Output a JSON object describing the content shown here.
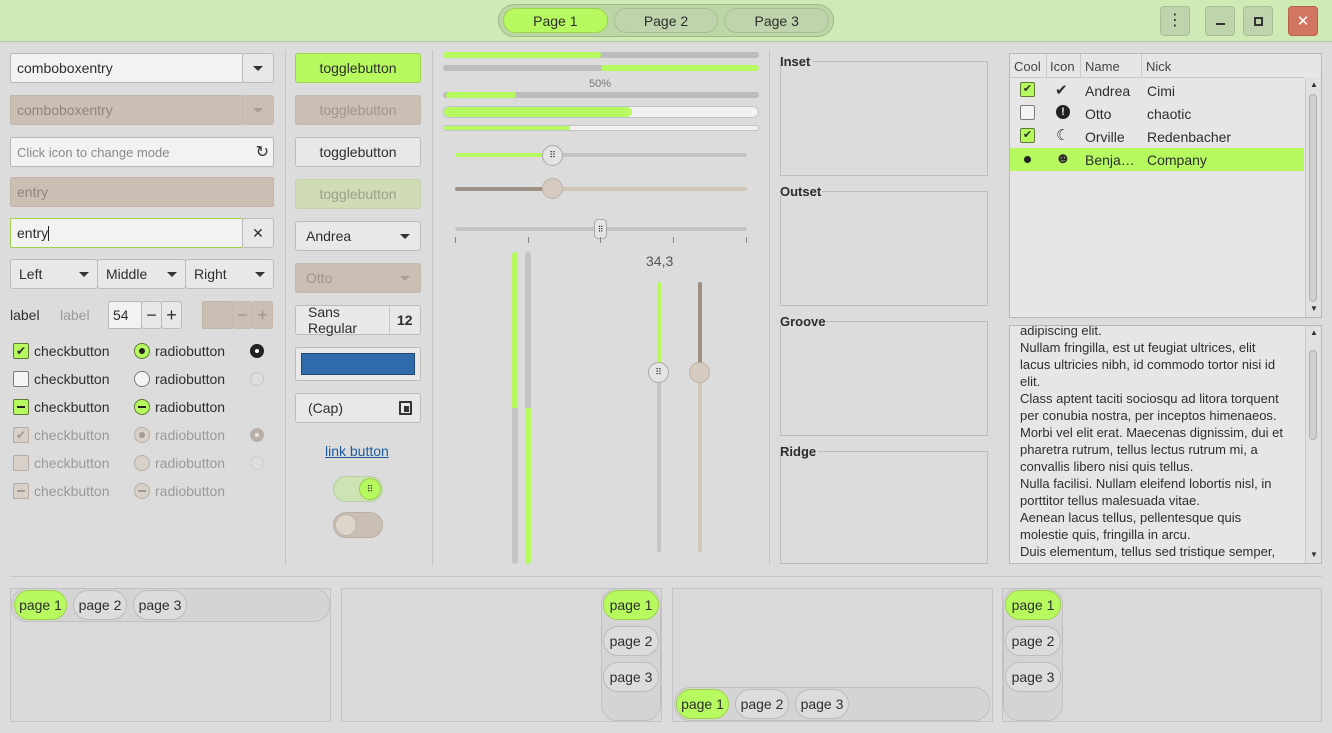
{
  "header": {
    "pages": [
      "Page 1",
      "Page 2",
      "Page 3"
    ],
    "active_page": 0
  },
  "col1": {
    "combo1": "comboboxentry",
    "combo2": "comboboxentry",
    "icon_entry_placeholder": "Click icon to change mode",
    "entry_disabled": "entry",
    "entry_focus": "entry",
    "seg": [
      "Left",
      "Middle",
      "Right"
    ],
    "label1": "label",
    "label2": "label",
    "spin_value": "54",
    "checks": [
      "checkbutton",
      "checkbutton",
      "checkbutton",
      "checkbutton",
      "checkbutton",
      "checkbutton"
    ],
    "radios": [
      "radiobutton",
      "radiobutton",
      "radiobutton",
      "radiobutton",
      "radiobutton",
      "radiobutton"
    ]
  },
  "col2": {
    "toggles": [
      "togglebutton",
      "togglebutton",
      "togglebutton",
      "togglebutton"
    ],
    "combo_andrea": "Andrea",
    "combo_otto": "Otto",
    "font_name": "Sans Regular",
    "font_size": "12",
    "color": "#2f6aab",
    "cap": "(Cap)",
    "link": "link button",
    "switch_on": true,
    "switch_off": false
  },
  "col3": {
    "progress_label": "50%",
    "progress": [
      0.5,
      0.5,
      0.22,
      0.6,
      0.4
    ],
    "hslider1": 0.33,
    "hslider2": 0.33,
    "hslider3": 0.5,
    "scale_value": "34,3",
    "vslider1": 0.3,
    "vslider2": 0.3
  },
  "frames": [
    "Inset",
    "Outset",
    "Groove",
    "Ridge"
  ],
  "tree": {
    "headers": [
      "Cool",
      "Icon",
      "Name",
      "Nick"
    ],
    "rows": [
      {
        "cool": "check",
        "icon": "check-circle-icon",
        "name": "Andrea",
        "nick": "Cimi"
      },
      {
        "cool": "empty",
        "icon": "exclamation-icon",
        "name": "Otto",
        "nick": "chaotic"
      },
      {
        "cool": "check",
        "icon": "moon-icon",
        "name": "Orville",
        "nick": "Redenbacher"
      },
      {
        "cool": "dot",
        "icon": "robot-icon",
        "name": "Benja…",
        "nick": "Company"
      }
    ]
  },
  "text": {
    "lines": [
      "adipiscing elit.",
      "Nullam fringilla, est ut feugiat ultrices, elit",
      "lacus ultricies nibh, id commodo tortor nisi id",
      "elit.",
      "Class aptent taciti sociosqu ad litora torquent",
      "per conubia nostra, per inceptos himenaeos.",
      "Morbi vel elit erat. Maecenas dignissim, dui et",
      "pharetra rutrum, tellus lectus rutrum mi, a",
      "convallis libero nisi quis tellus.",
      "Nulla facilisi. Nullam eleifend lobortis nisl, in",
      "porttitor tellus malesuada vitae.",
      "Aenean lacus tellus, pellentesque quis",
      "molestie quis, fringilla in arcu.",
      "Duis elementum, tellus sed tristique semper,"
    ]
  },
  "notebooks": {
    "tabs": [
      "page 1",
      "page 2",
      "page 3"
    ]
  },
  "colors": {
    "accent": "#b7fa5f",
    "header": "#cfeab4",
    "close": "#d27561"
  }
}
